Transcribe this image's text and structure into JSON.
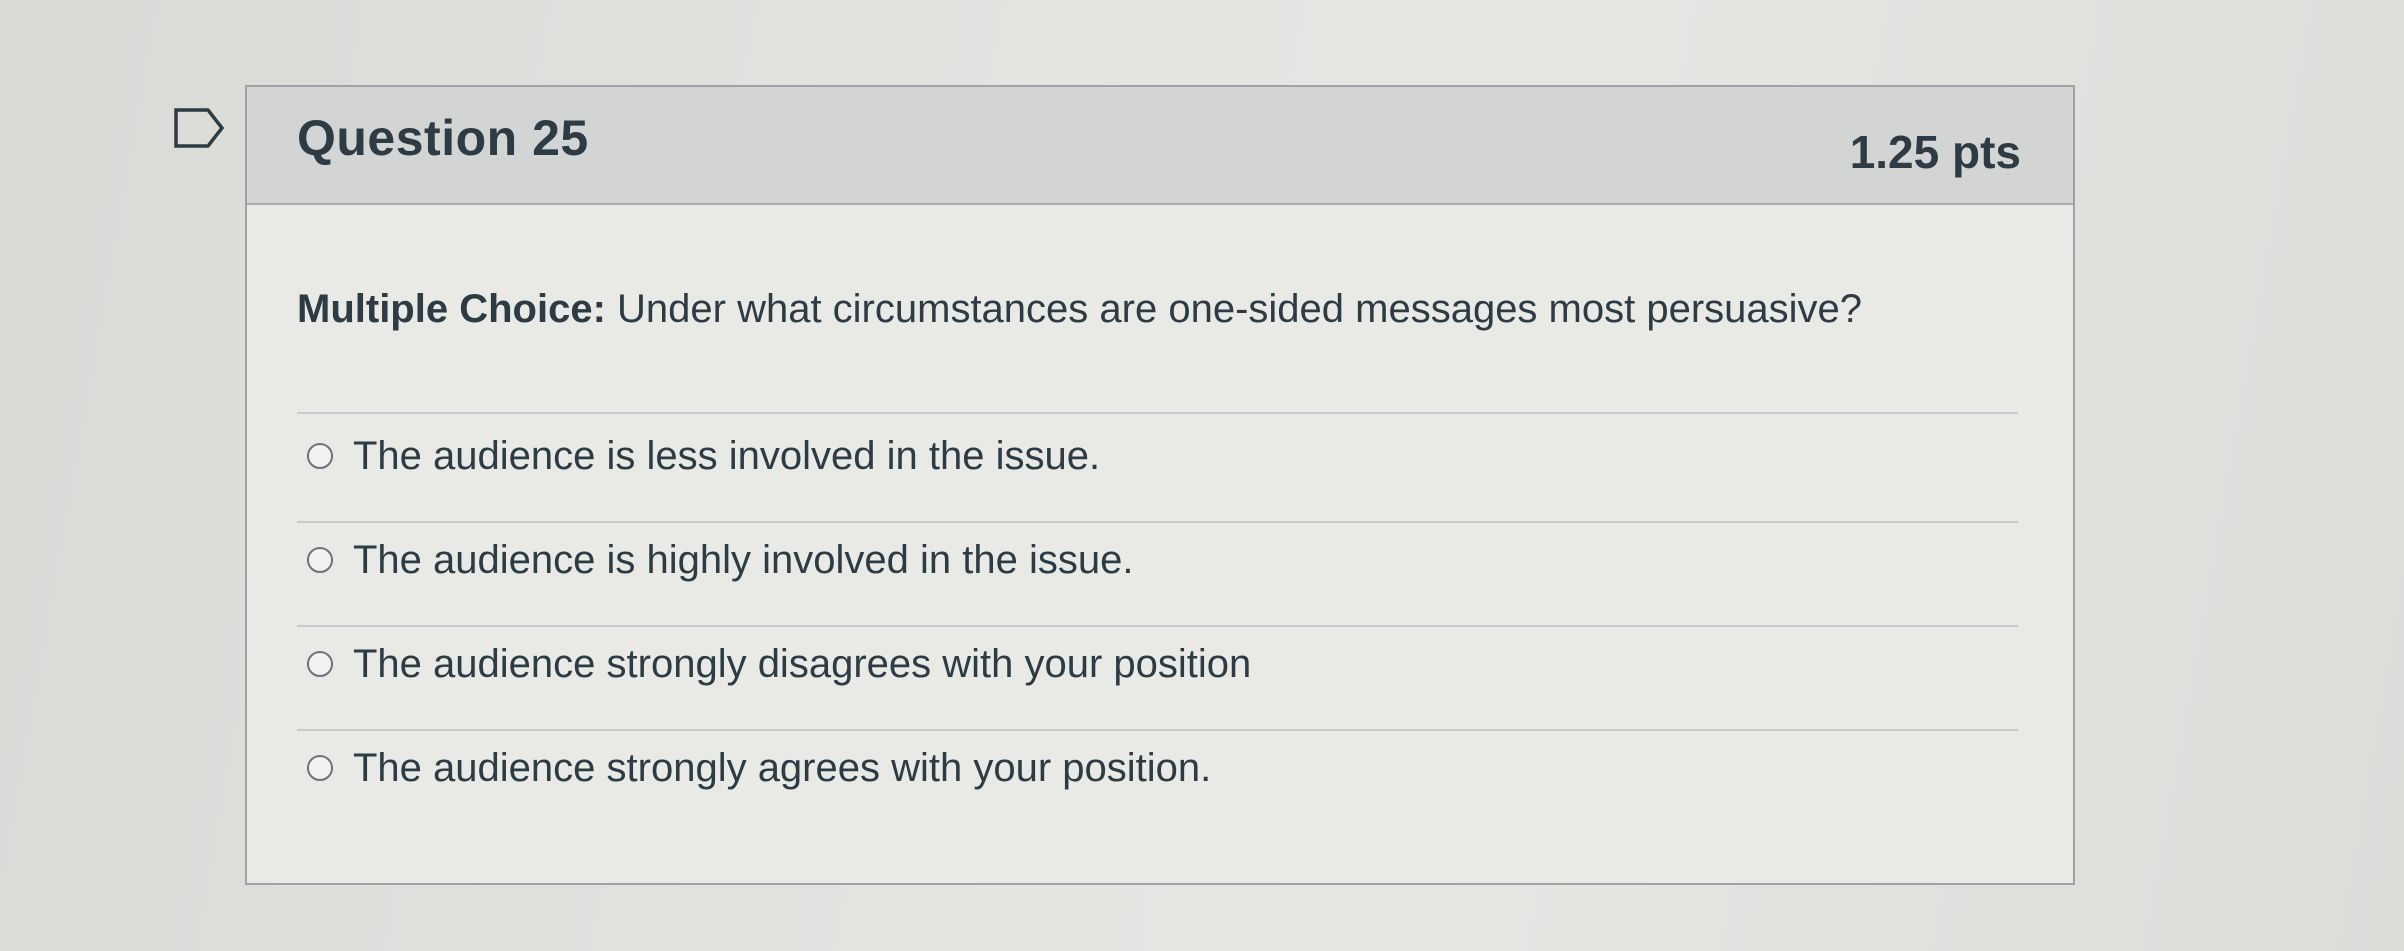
{
  "question": {
    "flag_icon": "flag-icon",
    "title": "Question 25",
    "points": "1.25 pts",
    "type_label": "Multiple Choice:",
    "prompt": " Under what circumstances are one-sided messages most persuasive?",
    "answers": [
      {
        "label": "The audience is less involved in the issue.",
        "selected": false
      },
      {
        "label": "The audience is highly involved in the issue.",
        "selected": false
      },
      {
        "label": "The audience strongly disagrees with your position",
        "selected": false
      },
      {
        "label": "The audience strongly agrees with your position.",
        "selected": false
      }
    ]
  }
}
